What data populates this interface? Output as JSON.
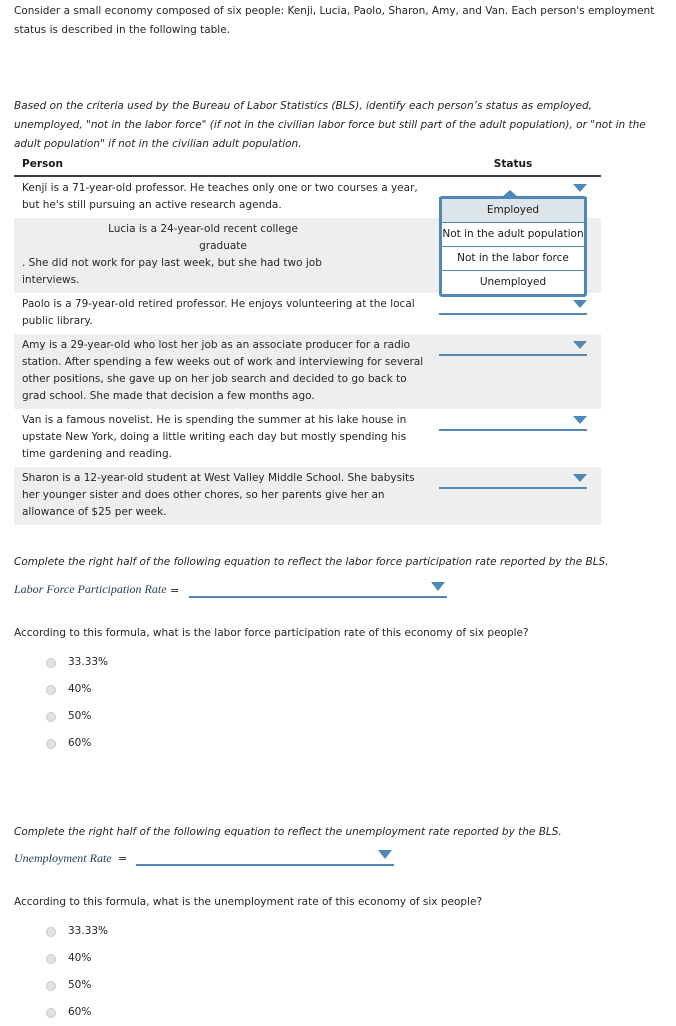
{
  "intro": {
    "text": "Consider a small economy composed of six people: Kenji, Lucia, Paolo, Sharon, Amy, and Van. Each person's employment status is described in the following table."
  },
  "criteria": {
    "text": "Based on the criteria used by the Bureau of Labor Statistics (BLS), identify each person’s status as employed, unemployed, \"not in the labor force\" (if not in the civilian labor force but still part of the adult population), or \"not in the adult population\" if not in the civilian adult population."
  },
  "table": {
    "headers": {
      "person": "Person",
      "status": "Status"
    },
    "rows": [
      {
        "person": "Kenji is a 71-year-old professor. He teaches only one or two courses a year, but he's still pursuing an active research agenda.",
        "status_value": ""
      },
      {
        "person_line1": "Lucia is a 24-year-old recent college",
        "person_line2": "graduate",
        "person_line3": ". She did not work for pay last week, but she had two job",
        "person_line4": "interviews.",
        "status_value": ""
      },
      {
        "person": "Paolo is a 79-year-old retired professor. He enjoys volunteering at the local public library.",
        "status_value": ""
      },
      {
        "person": "Amy is a 29-year-old who lost her job as an associate producer for a radio station. After spending a few weeks out of work and interviewing for several other positions, she gave up on her job search and decided to go back to grad school. She made that decision a few months ago.",
        "status_value": ""
      },
      {
        "person": "Van is a famous novelist. He is spending the summer at his lake house in upstate New York, doing a little writing each day but mostly spending his time gardening and reading.",
        "status_value": ""
      },
      {
        "person": "Sharon is a 12-year-old student at West Valley Middle School. She babysits her younger sister and does other chores, so her parents give her an allowance of $25 per week.",
        "status_value": ""
      }
    ]
  },
  "open_dropdown": {
    "for_row": "Kenji",
    "selected": "Employed",
    "options": [
      "Employed",
      "Not in the adult population",
      "Not in the labor force",
      "Unemployed"
    ]
  },
  "lfpr_section": {
    "instruction": "Complete the right half of the following equation to reflect the labor force participation rate reported by the BLS.",
    "equation_label": "Labor Force Participation Rate",
    "equals": "=",
    "equation_value": "",
    "question": "According to this formula, what is the labor force participation rate of this economy of six people?",
    "options": [
      "33.33%",
      "40%",
      "50%",
      "60%"
    ]
  },
  "unemployment_section": {
    "instruction": "Complete the right half of the following equation to reflect the unemployment rate reported by the BLS.",
    "equation_label": "Unemployment Rate",
    "equals": "=",
    "equation_value": "",
    "question": "According to this formula, what is the unemployment rate of this economy of six people?",
    "options": [
      "33.33%",
      "40%",
      "50%",
      "60%"
    ]
  },
  "colors": {
    "accent_blue": "#4d88b8",
    "row_stripe": "#eeeeee",
    "selected_option_bg": "#dde5ea",
    "header_rule": "#3d3d3d"
  },
  "icons": {
    "dropdown_caret": "chevron-down-icon",
    "radio": "radio-unselected-icon"
  }
}
